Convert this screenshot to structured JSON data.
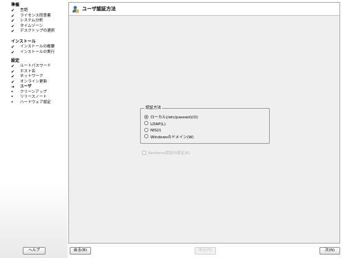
{
  "sidebar": {
    "sections": [
      {
        "title": "準備",
        "items": [
          {
            "label": "言語",
            "mark": "✔"
          },
          {
            "label": "ライセンス同意書",
            "mark": "✔"
          },
          {
            "label": "システム分析",
            "mark": "✔"
          },
          {
            "label": "タイムゾーン",
            "mark": "✔"
          },
          {
            "label": "デスクトップの選択",
            "mark": "✔"
          }
        ]
      },
      {
        "title": "インストール",
        "items": [
          {
            "label": "インストールの概要",
            "mark": "✔"
          },
          {
            "label": "インストールの実行",
            "mark": "✔"
          }
        ]
      },
      {
        "title": "設定",
        "items": [
          {
            "label": "ルートパスワード",
            "mark": "✔"
          },
          {
            "label": "ホスト名",
            "mark": "✔"
          },
          {
            "label": "ネットワーク",
            "mark": "✔"
          },
          {
            "label": "オンライン更新",
            "mark": "✔"
          },
          {
            "label": "ユーザ",
            "mark": "➜"
          },
          {
            "label": "クリーンアップ",
            "mark": "•"
          },
          {
            "label": "リリースノート",
            "mark": "•"
          },
          {
            "label": "ハードウェア設定",
            "mark": "•"
          }
        ]
      }
    ]
  },
  "main": {
    "title": "ユーザ認証方法",
    "auth_group": {
      "legend": "認証方法",
      "options": [
        {
          "label": "ローカル(/etc/passwd)(O)",
          "selected": true
        },
        {
          "label": "LDAP(L)",
          "selected": false
        },
        {
          "label": "NIS(I)",
          "selected": false
        },
        {
          "label": "Windowsのドメイン(W)",
          "selected": false
        }
      ]
    },
    "kerberos_label": "Kerberos認証の設定(K)"
  },
  "buttons": {
    "help": "ヘルプ",
    "back": "戻る(B)",
    "abort": "中止(T)",
    "next": "次(N)"
  },
  "colors": {
    "panel_bg": "#efefef",
    "title_bg": "#ffffff",
    "disabled_text": "#b4b4b4"
  },
  "icons": {
    "title": "user-settings-icon",
    "completed": "check-icon",
    "current": "arrow-right-icon",
    "pending": "bullet-icon"
  }
}
